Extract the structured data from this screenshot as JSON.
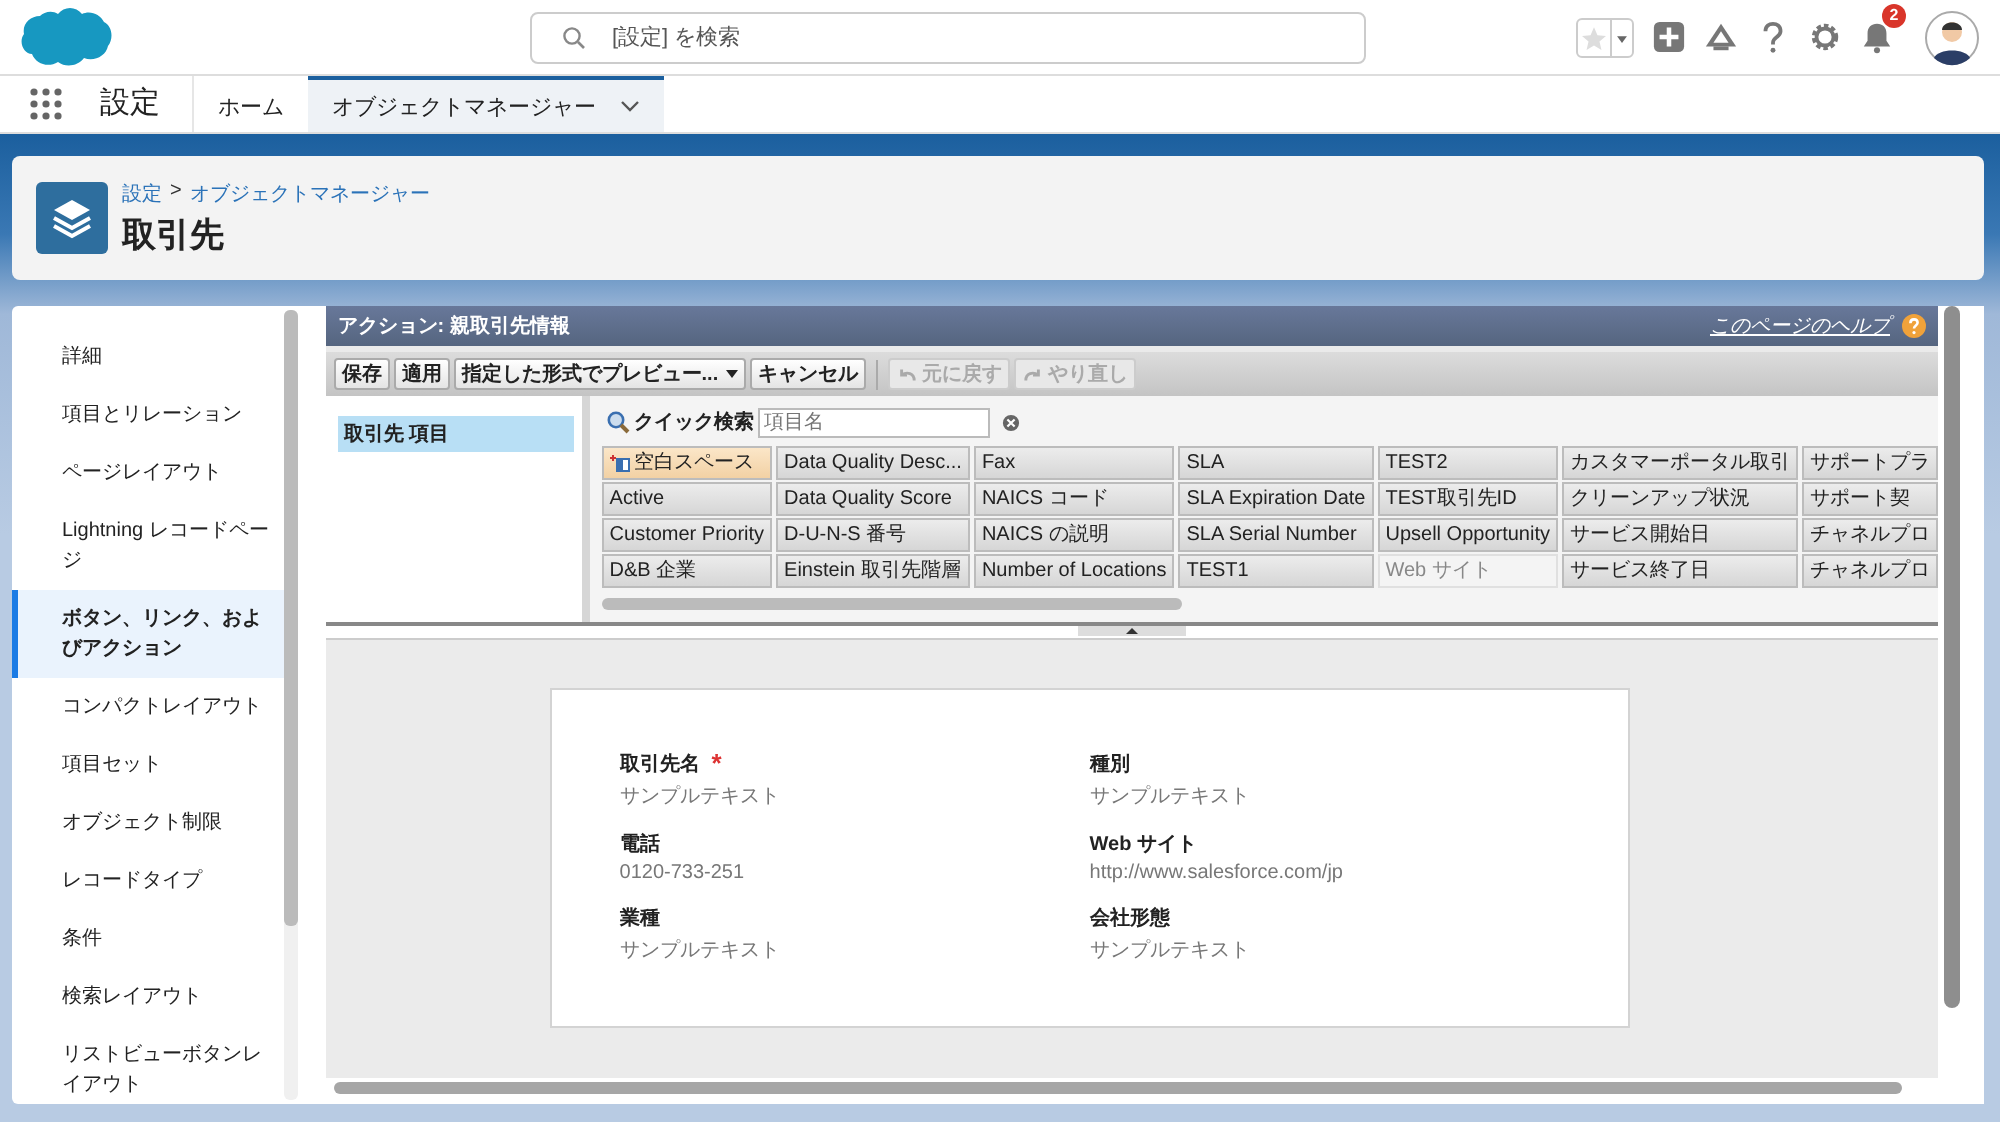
{
  "topbar": {
    "search": {
      "placeholder": "[設定] を検索"
    },
    "notifications": "2"
  },
  "nav": {
    "app_name": "設定",
    "tabs": [
      {
        "label": "ホーム",
        "selected": false,
        "dropdown": false
      },
      {
        "label": "オブジェクトマネージャー",
        "selected": true,
        "dropdown": true
      }
    ]
  },
  "header": {
    "breadcrumb": [
      "設定",
      "オブジェクトマネージャー"
    ],
    "separator": ">",
    "title": "取引先"
  },
  "sidebar": {
    "items": [
      {
        "label": "詳細",
        "selected": false
      },
      {
        "label": "項目とリレーション",
        "selected": false
      },
      {
        "label": "ページレイアウト",
        "selected": false
      },
      {
        "label": "Lightning レコードページ",
        "selected": false
      },
      {
        "label": "ボタン、リンク、およびアクション",
        "selected": true
      },
      {
        "label": "コンパクトレイアウト",
        "selected": false
      },
      {
        "label": "項目セット",
        "selected": false
      },
      {
        "label": "オブジェクト制限",
        "selected": false
      },
      {
        "label": "レコードタイプ",
        "selected": false
      },
      {
        "label": "条件",
        "selected": false
      },
      {
        "label": "検索レイアウト",
        "selected": false
      },
      {
        "label": "リストビューボタンレイアウト",
        "selected": false
      }
    ]
  },
  "editor": {
    "required_mark": "*",
    "title": "アクション: 親取引先情報",
    "help": "このページのヘルプ",
    "toolbar": [
      {
        "label": "保存",
        "disabled": false,
        "kind": "button"
      },
      {
        "label": "適用",
        "disabled": false,
        "kind": "button"
      },
      {
        "label": "指定した形式でプレビュー...",
        "disabled": false,
        "kind": "menu"
      },
      {
        "label": "キャンセル",
        "disabled": false,
        "kind": "button"
      },
      {
        "label": "元に戻す",
        "disabled": true,
        "kind": "undo"
      },
      {
        "label": "やり直し",
        "disabled": true,
        "kind": "redo"
      }
    ],
    "categories": [
      {
        "label": "取引先 項目",
        "selected": true
      }
    ],
    "quick_find": {
      "label": "クイック検索",
      "placeholder": "項目名"
    },
    "palette_rows": [
      [
        {
          "label": "空白スペース",
          "kind": "blank",
          "in_layout": false
        },
        {
          "label": "Data Quality Desc...",
          "kind": "field",
          "in_layout": false
        },
        {
          "label": "Fax",
          "kind": "field",
          "in_layout": false
        },
        {
          "label": "SLA",
          "kind": "field",
          "in_layout": false
        },
        {
          "label": "TEST2",
          "kind": "field",
          "in_layout": false
        },
        {
          "label": "カスタマーポータル取引",
          "kind": "field",
          "in_layout": false
        },
        {
          "label": "サポートプラ",
          "kind": "field",
          "in_layout": false
        }
      ],
      [
        {
          "label": "Active",
          "kind": "field",
          "in_layout": false
        },
        {
          "label": "Data Quality Score",
          "kind": "field",
          "in_layout": false
        },
        {
          "label": "NAICS コード",
          "kind": "field",
          "in_layout": false
        },
        {
          "label": "SLA Expiration Date",
          "kind": "field",
          "in_layout": false
        },
        {
          "label": "TEST取引先ID",
          "kind": "field",
          "in_layout": false
        },
        {
          "label": "クリーンアップ状況",
          "kind": "field",
          "in_layout": false
        },
        {
          "label": "サポート契",
          "kind": "field",
          "in_layout": false
        }
      ],
      [
        {
          "label": "Customer Priority",
          "kind": "field",
          "in_layout": false
        },
        {
          "label": "D-U-N-S 番号",
          "kind": "field",
          "in_layout": false
        },
        {
          "label": "NAICS の説明",
          "kind": "field",
          "in_layout": false
        },
        {
          "label": "SLA Serial Number",
          "kind": "field",
          "in_layout": false
        },
        {
          "label": "Upsell Opportunity",
          "kind": "field",
          "in_layout": false
        },
        {
          "label": "サービス開始日",
          "kind": "field",
          "in_layout": false
        },
        {
          "label": "チャネルプロ",
          "kind": "field",
          "in_layout": false
        }
      ],
      [
        {
          "label": "D&B 企業",
          "kind": "field",
          "in_layout": false
        },
        {
          "label": "Einstein 取引先階層",
          "kind": "field",
          "in_layout": false
        },
        {
          "label": "Number of Locations",
          "kind": "field",
          "in_layout": false
        },
        {
          "label": "TEST1",
          "kind": "field",
          "in_layout": false
        },
        {
          "label": "Web サイト",
          "kind": "field",
          "in_layout": true
        },
        {
          "label": "サービス終了日",
          "kind": "field",
          "in_layout": false
        },
        {
          "label": "チャネルプロ",
          "kind": "field",
          "in_layout": false
        }
      ]
    ],
    "preview_fields": [
      {
        "label": "取引先名",
        "value": "サンプルテキスト",
        "required": true
      },
      {
        "label": "種別",
        "value": "サンプルテキスト",
        "required": false
      },
      {
        "label": "電話",
        "value": "0120-733-251",
        "required": false
      },
      {
        "label": "Web サイト",
        "value": "http://www.salesforce.com/jp",
        "required": false
      },
      {
        "label": "業種",
        "value": "サンプルテキスト",
        "required": false
      },
      {
        "label": "会社形態",
        "value": "サンプルテキスト",
        "required": false
      }
    ]
  }
}
